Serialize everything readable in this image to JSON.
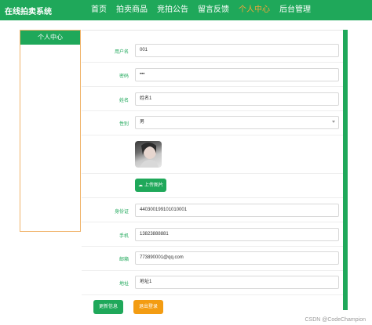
{
  "app": {
    "title": "在线拍卖系统"
  },
  "nav": [
    {
      "label": "首页",
      "active": false
    },
    {
      "label": "拍卖商品",
      "active": false
    },
    {
      "label": "竞拍公告",
      "active": false
    },
    {
      "label": "留言反馈",
      "active": false
    },
    {
      "label": "个人中心",
      "active": true
    },
    {
      "label": "后台管理",
      "active": false
    }
  ],
  "sidebar": {
    "title": "个人中心"
  },
  "form": {
    "username": {
      "label": "用户名",
      "value": "001"
    },
    "password": {
      "label": "密码",
      "value": "•••"
    },
    "name": {
      "label": "姓名",
      "value": "姓名1"
    },
    "gender": {
      "label": "性别",
      "value": "男"
    },
    "upload": {
      "label": "上传图片"
    },
    "id_card": {
      "label": "身份证",
      "value": "440300199101010001"
    },
    "phone": {
      "label": "手机",
      "value": "13823888881"
    },
    "email": {
      "label": "邮箱",
      "value": "773890001@qq.com"
    },
    "address": {
      "label": "地址",
      "value": "地址1"
    }
  },
  "buttons": {
    "update": "更新信息",
    "logout": "退出登录"
  },
  "watermark": "CSDN @CodeChampion",
  "colors": {
    "primary": "#1fa85a",
    "accent": "#f39c12",
    "nav_active": "#f3a43a"
  }
}
